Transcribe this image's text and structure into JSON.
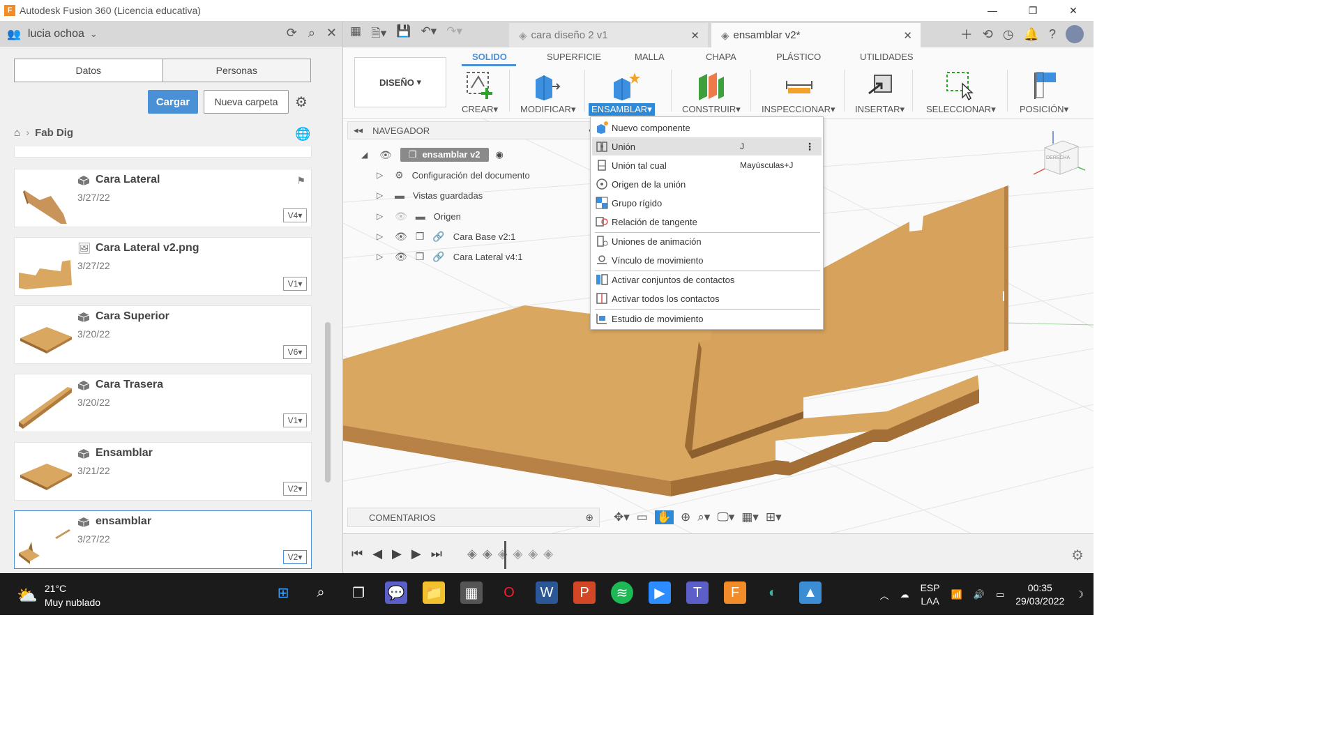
{
  "window": {
    "title": "Autodesk Fusion 360 (Licencia educativa)",
    "logo": "F"
  },
  "data_panel": {
    "user": "lucia ochoa",
    "tabs": [
      "Datos",
      "Personas"
    ],
    "upload_label": "Cargar",
    "new_folder_label": "Nueva carpeta",
    "breadcrumb": "Fab Dig",
    "items": [
      {
        "name": "Cara Lateral",
        "date": "3/27/22",
        "version": "V4"
      },
      {
        "name": "Cara Lateral v2.png",
        "date": "3/27/22",
        "version": "V1"
      },
      {
        "name": "Cara Superior",
        "date": "3/20/22",
        "version": "V6"
      },
      {
        "name": "Cara Trasera",
        "date": "3/20/22",
        "version": "V1"
      },
      {
        "name": "Ensamblar",
        "date": "3/21/22",
        "version": "V2"
      },
      {
        "name": "ensamblar",
        "date": "3/27/22",
        "version": "V2"
      }
    ]
  },
  "doc_tabs": {
    "inactive": "cara diseño 2 v1",
    "active": "ensamblar v2*"
  },
  "ribbon": {
    "workspace": "DISEÑO",
    "tabs": [
      "SOLIDO",
      "SUPERFICIE",
      "MALLA",
      "CHAPA",
      "PLÁSTICO",
      "UTILIDADES"
    ],
    "groups": [
      "CREAR",
      "MODIFICAR",
      "ENSAMBLAR",
      "CONSTRUIR",
      "INSPECCIONAR",
      "INSERTAR",
      "SELECCIONAR",
      "POSICIÓN"
    ]
  },
  "navigator": {
    "title": "NAVEGADOR",
    "root": "ensamblar v2",
    "rows": [
      "Configuración del documento",
      "Vistas guardadas",
      "Origen",
      "Cara Base v2:1",
      "Cara Lateral v4:1"
    ]
  },
  "menu": {
    "items": [
      {
        "label": "Nuevo componente",
        "shortcut": ""
      },
      {
        "label": "Unión",
        "shortcut": "J"
      },
      {
        "label": "Unión tal cual",
        "shortcut": "Mayúsculas+J"
      },
      {
        "label": "Origen de la unión",
        "shortcut": ""
      },
      {
        "label": "Grupo rígido",
        "shortcut": ""
      },
      {
        "label": "Relación de tangente",
        "shortcut": ""
      },
      {
        "label": "Uniones de animación",
        "shortcut": ""
      },
      {
        "label": "Vínculo de movimiento",
        "shortcut": ""
      },
      {
        "label": "Activar conjuntos de contactos",
        "shortcut": ""
      },
      {
        "label": "Activar todos los contactos",
        "shortcut": ""
      },
      {
        "label": "Estudio de movimiento",
        "shortcut": ""
      }
    ]
  },
  "viewcube": {
    "face": "DERECHA"
  },
  "comments": {
    "label": "COMENTARIOS"
  },
  "taskbar": {
    "temp": "21°C",
    "weather": "Muy nublado",
    "lang1": "ESP",
    "lang2": "LAA",
    "time": "00:35",
    "date": "29/03/2022"
  },
  "colors": {
    "accent": "#2d8ad8",
    "wood": "#d9a75f",
    "cargar": "#4a90d6"
  }
}
